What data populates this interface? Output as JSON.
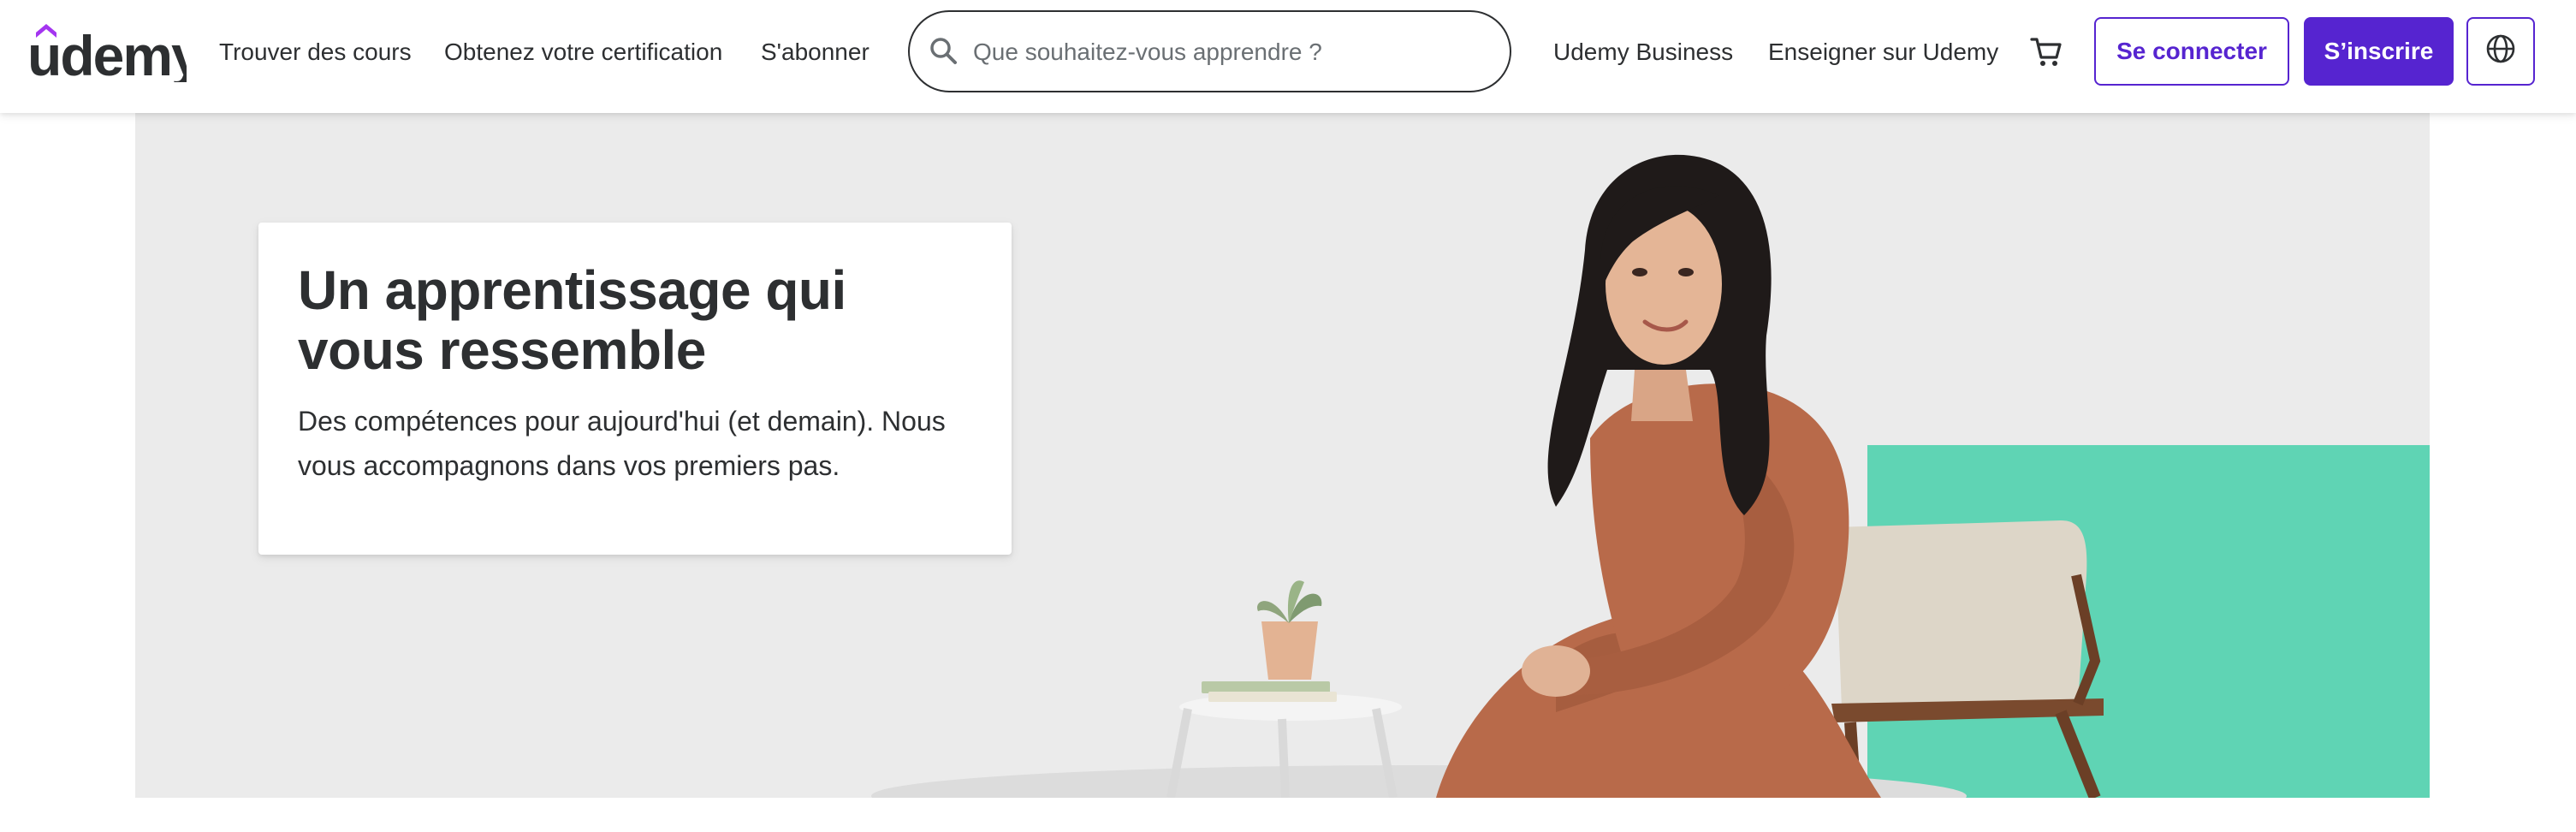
{
  "header": {
    "logo_text": "udemy",
    "nav": {
      "find_courses": "Trouver des cours",
      "certification": "Obtenez votre certification",
      "subscribe": "S'abonner",
      "business": "Udemy Business",
      "teach": "Enseigner sur Udemy"
    },
    "search": {
      "placeholder": "Que souhaitez-vous apprendre ?",
      "value": ""
    },
    "icons": {
      "search": "search-icon",
      "cart": "cart-icon",
      "language": "globe-icon"
    },
    "login_label": "Se connecter",
    "signup_label": "S’inscrire"
  },
  "hero": {
    "title": "Un apprentissage qui vous ressemble",
    "subtitle": "Des compétences pour aujourd'hui (et demain). Nous vous accompagnons dans vos premiers pas."
  },
  "colors": {
    "brand": "#5624d0",
    "logo_accent": "#a435f0",
    "text": "#2d2f31",
    "hero_background": "#ebebeb",
    "hero_accent": "#5fd4b4",
    "dress": "#b86a4a"
  }
}
